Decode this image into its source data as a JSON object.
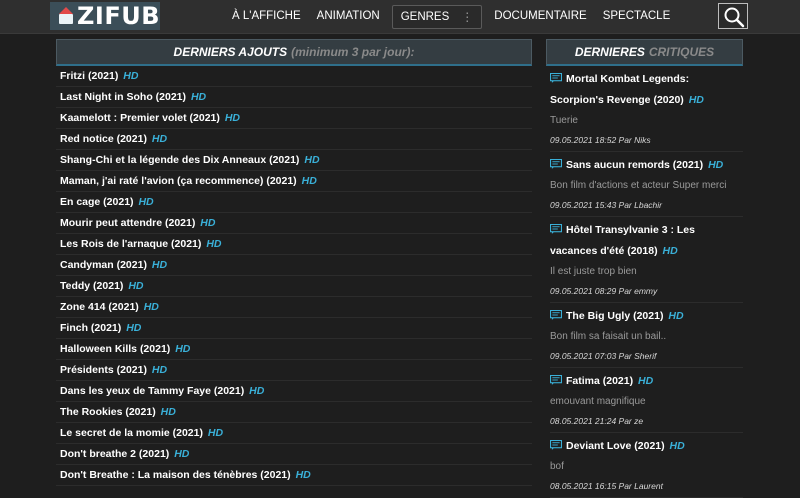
{
  "header": {
    "logo_text": "ZIFUB",
    "nav": [
      "À L'AFFICHE",
      "ANIMATION",
      "GENRES",
      "DOCUMENTAIRE",
      "SPECTACLE"
    ],
    "genres_dots": "⋮"
  },
  "latest": {
    "title": "DERNIERS AJOUTS",
    "subtitle": "(minimum 3 par jour):",
    "quality_label": "HD",
    "items": [
      "Fritzi (2021)",
      "Last Night in Soho (2021)",
      "Kaamelott : Premier volet (2021)",
      "Red notice (2021)",
      "Shang-Chi et la légende des Dix Anneaux (2021)",
      "Maman, j'ai raté l'avion (ça recommence) (2021)",
      "En cage (2021)",
      "Mourir peut attendre (2021)",
      "Les Rois de l'arnaque (2021)",
      "Candyman (2021)",
      "Teddy (2021)",
      "Zone 414 (2021)",
      "Finch (2021)",
      "Halloween Kills (2021)",
      "Présidents (2021)",
      "Dans les yeux de Tammy Faye (2021)",
      "The Rookies (2021)",
      "Le secret de la momie (2021)",
      "Don't breathe 2 (2021)",
      "Don't Breathe : La maison des ténèbres (2021)"
    ]
  },
  "reviews": {
    "title_a": "DERNIERES",
    "title_b": "CRITIQUES",
    "quality_label": "HD",
    "items": [
      {
        "title": "Mortal Kombat Legends: Scorpion's Revenge (2020)",
        "text": "Tuerie",
        "meta": "09.05.2021 18:52 Par Niks"
      },
      {
        "title": "Sans aucun remords (2021)",
        "text": "Bon film d'actions et acteur Super merci",
        "meta": "09.05.2021 15:43 Par Lbachir"
      },
      {
        "title": "Hôtel Transylvanie 3 : Les vacances d'été (2018)",
        "text": "Il est juste trop bien",
        "meta": "09.05.2021 08:29 Par emmy"
      },
      {
        "title": "The Big Ugly (2021)",
        "text": "Bon film sa faisait un bail..",
        "meta": "09.05.2021 07:03 Par Sherif"
      },
      {
        "title": "Fatima (2021)",
        "text": "emouvant magnifique",
        "meta": "08.05.2021 21:24 Par ze"
      },
      {
        "title": "Deviant Love (2021)",
        "text": "bof",
        "meta": "08.05.2021 16:15 Par Laurent"
      }
    ]
  },
  "colors": {
    "accent": "#3ab0d8",
    "header_bg": "#2f2f2f",
    "page_bg": "#1e1e1e"
  }
}
